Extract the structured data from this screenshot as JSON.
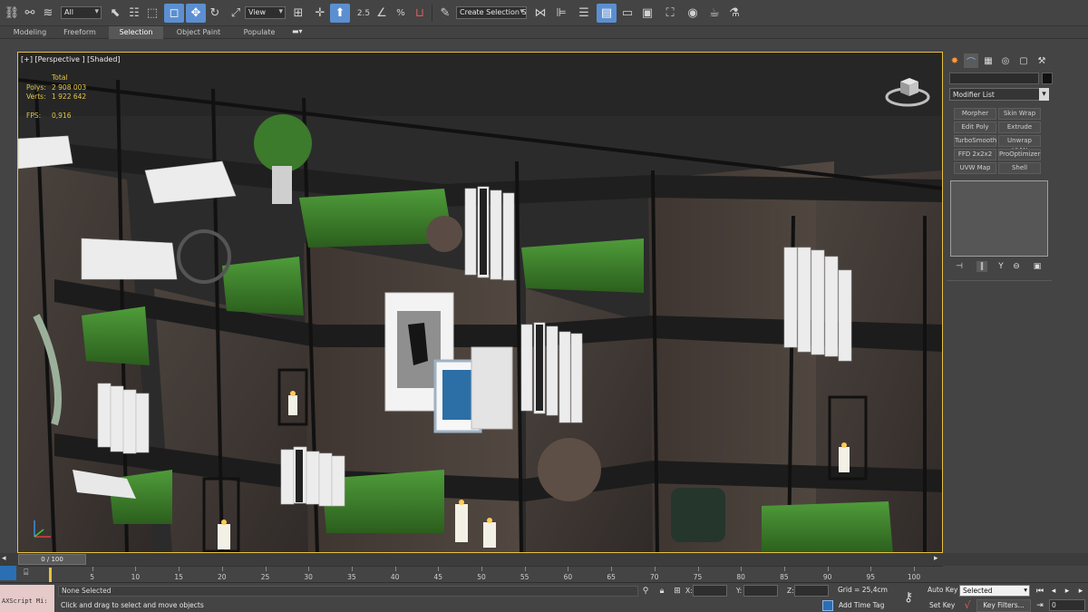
{
  "toolbar": {
    "selection_filter": "All",
    "ref_coord": "View",
    "snap_label": "2.5",
    "named_selection_placeholder": "Create Selection Se"
  },
  "ribbon": {
    "tabs": [
      {
        "label": "Modeling"
      },
      {
        "label": "Freeform"
      },
      {
        "label": "Selection",
        "active": true
      },
      {
        "label": "Object Paint"
      },
      {
        "label": "Populate"
      }
    ]
  },
  "viewport": {
    "label": "[+] [Perspective ] [Shaded]",
    "stats": {
      "header": "Total",
      "polys_label": "Polys:",
      "polys_value": "2 908 003",
      "verts_label": "Verts:",
      "verts_value": "1 922 642",
      "fps_label": "FPS:",
      "fps_value": "0,916"
    },
    "border_color": "#e8c143"
  },
  "command_panel": {
    "modifier_list": "Modifier List",
    "modifier_buttons": [
      "Morpher",
      "Skin Wrap",
      "Edit Poly",
      "Extrude",
      "TurboSmooth",
      "Unwrap UVW",
      "FFD 2x2x2",
      "ProOptimizer",
      "UVW Map",
      "Shell"
    ]
  },
  "timeline": {
    "frame_display": "0 / 100",
    "ticks": [
      "5",
      "10",
      "15",
      "20",
      "25",
      "30",
      "35",
      "40",
      "45",
      "50",
      "55",
      "60",
      "65",
      "70",
      "75",
      "80",
      "85",
      "90",
      "95",
      "100"
    ]
  },
  "statusbar": {
    "maxscript": "AXScript Mi:",
    "selection": "None Selected",
    "prompt": "Click and drag to select and move objects",
    "x_label": "X:",
    "y_label": "Y:",
    "z_label": "Z:",
    "grid": "Grid = 25,4cm",
    "add_time_tag": "Add Time Tag",
    "auto_key": "Auto Key",
    "set_key": "Set Key",
    "selected_dropdown": "Selected",
    "key_filters": "Key Filters...",
    "current_frame": "0"
  },
  "colors": {
    "accent": "#5b8fd1",
    "viewport_border": "#e8c143",
    "stats_text": "#e3c64a"
  }
}
